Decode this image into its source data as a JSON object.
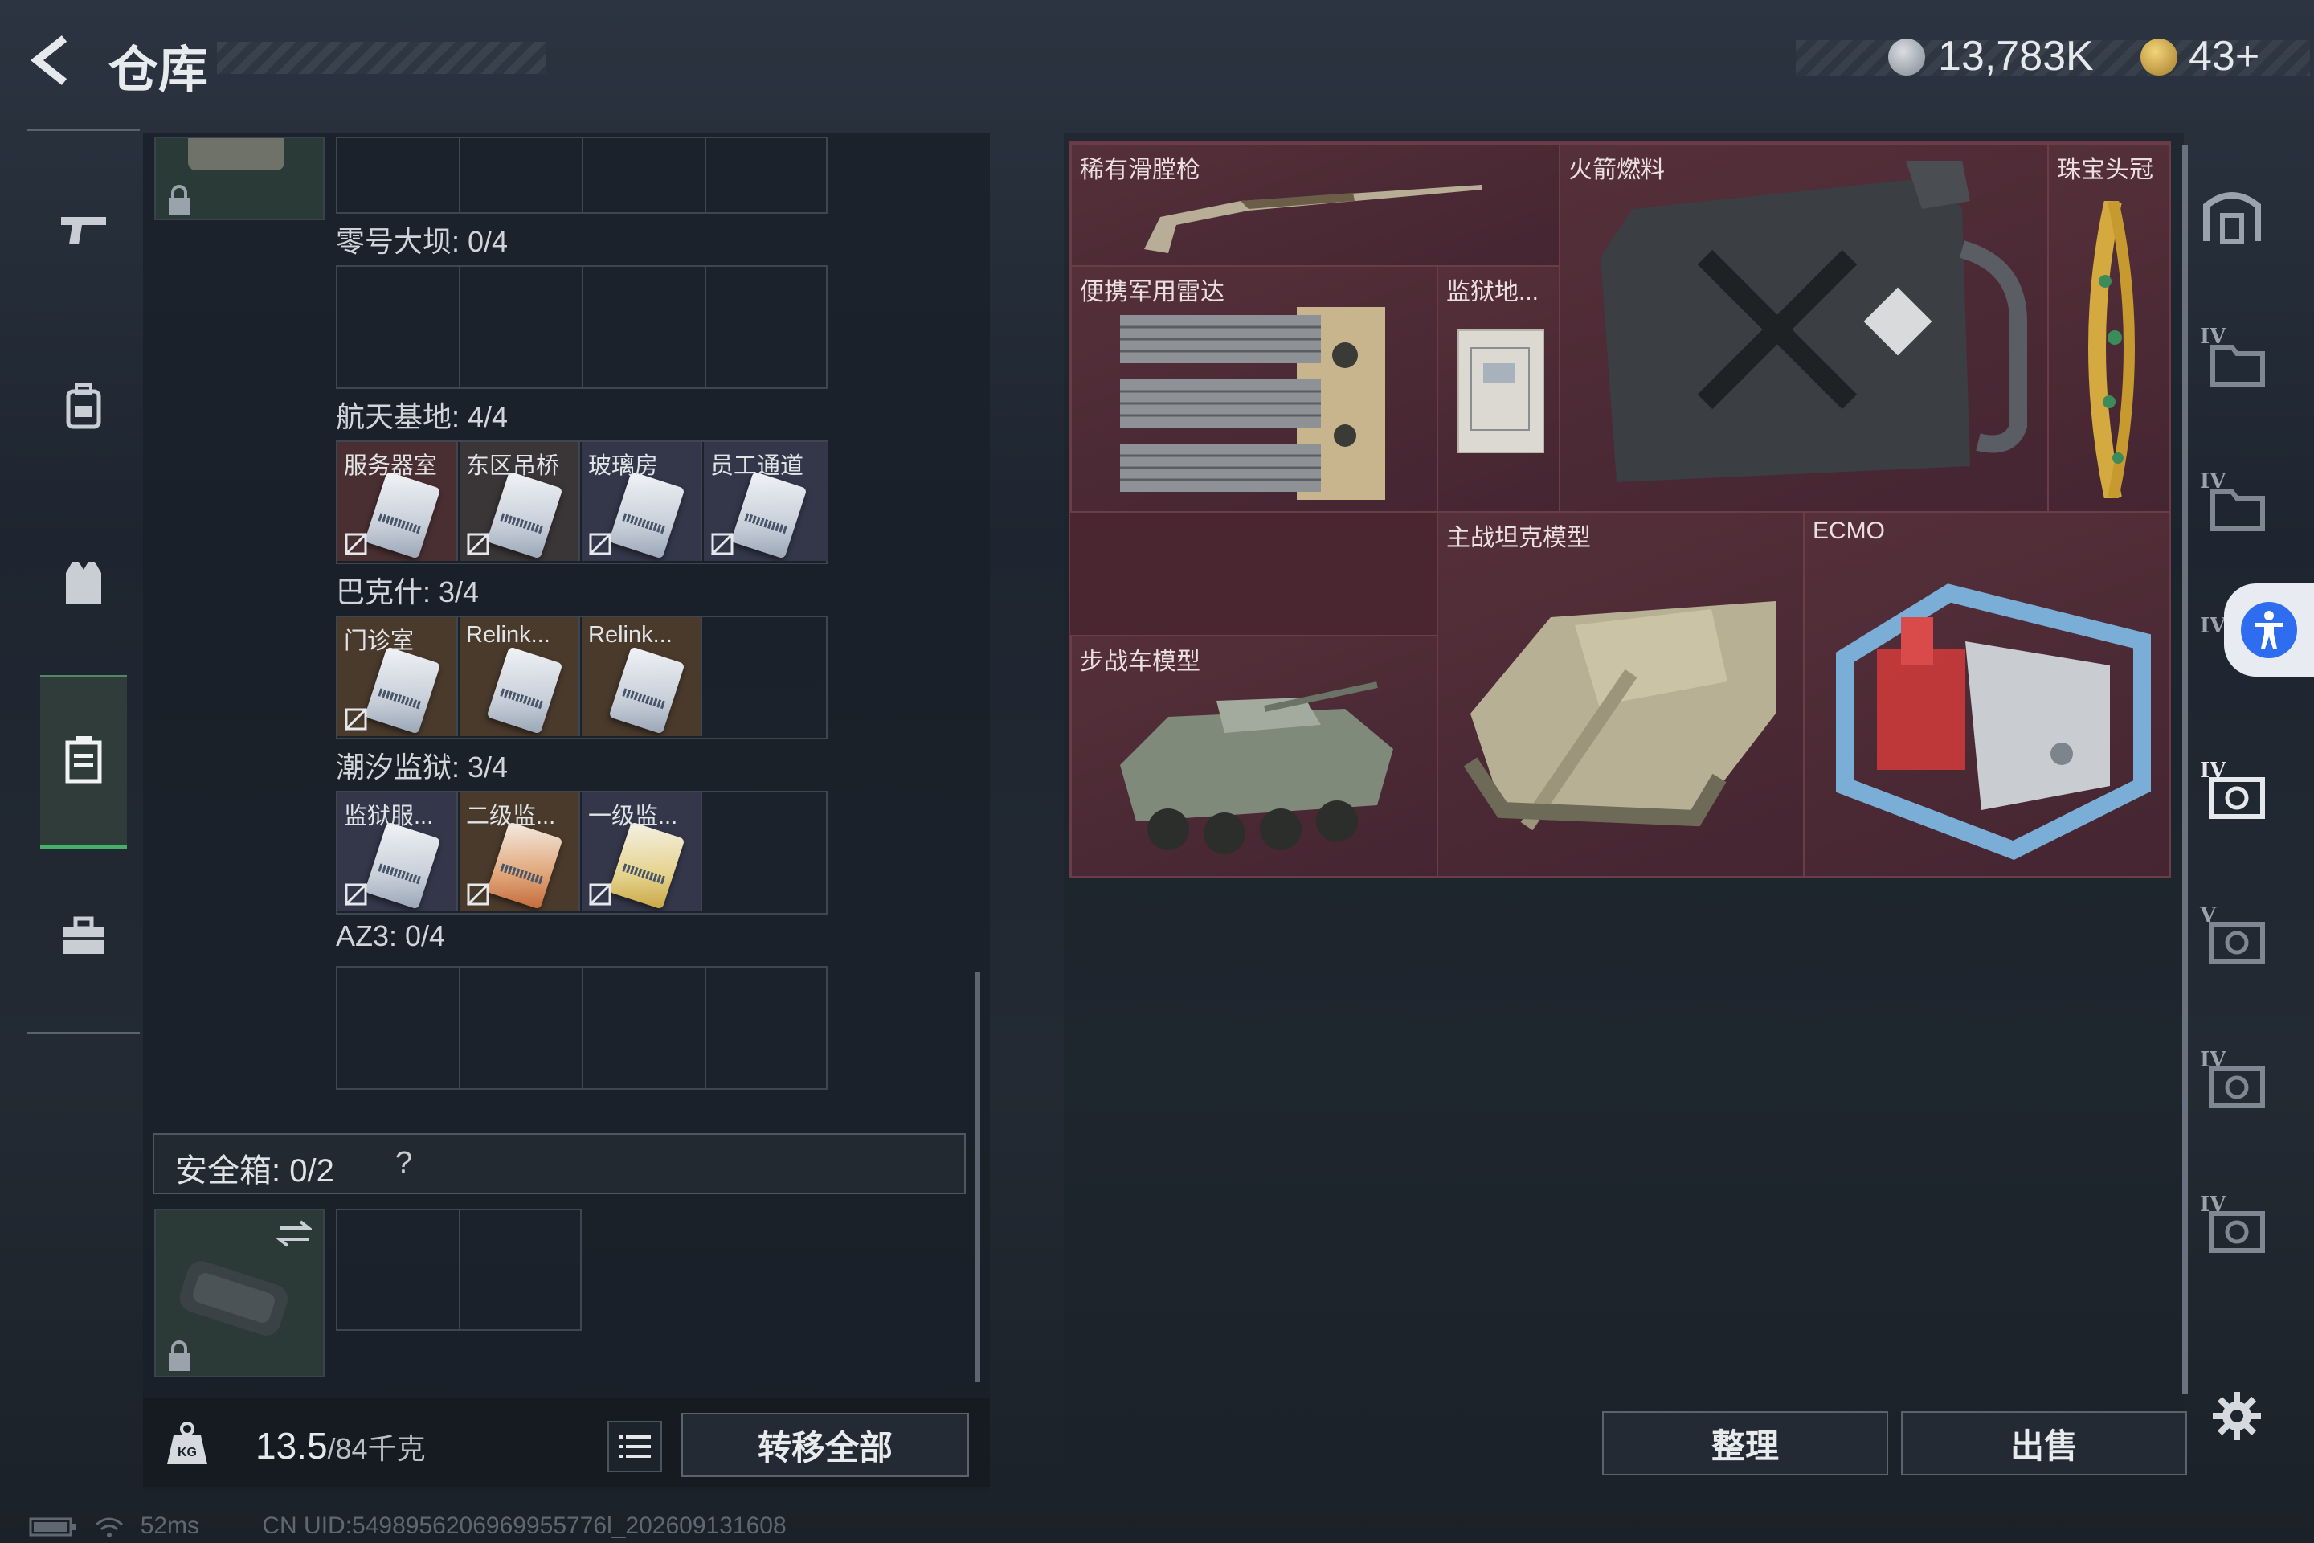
{
  "header": {
    "title": "仓库"
  },
  "currency": {
    "silver": "13,783K",
    "gold": "43+"
  },
  "left_nav": {
    "items": [
      "weapon-tab",
      "backpack-tab",
      "vest-tab",
      "keycard-case-tab",
      "toolbox-tab"
    ],
    "active": "keycard-case-tab"
  },
  "keycard_sections": [
    {
      "title": "零号大坝: 0/4",
      "cards": []
    },
    {
      "title": "航天基地: 4/4",
      "cards": [
        "服务器室",
        "东区吊桥",
        "玻璃房",
        "员工通道"
      ]
    },
    {
      "title": "巴克什: 3/4",
      "cards": [
        "门诊室",
        "Relink...",
        "Relink..."
      ]
    },
    {
      "title": "潮汐监狱: 3/4",
      "cards": [
        "监狱服...",
        "二级监...",
        "一级监..."
      ]
    },
    {
      "title": "AZ3: 0/4",
      "cards": []
    }
  ],
  "safe_box": {
    "label": "安全箱: 0/2",
    "help": "?"
  },
  "weight": {
    "current": "13.5",
    "max": "/84千克"
  },
  "buttons": {
    "transfer_all": "转移全部",
    "sort": "整理",
    "sell": "出售"
  },
  "items": [
    {
      "name": "稀有滑膛枪"
    },
    {
      "name": "火箭燃料"
    },
    {
      "name": "珠宝头冠"
    },
    {
      "name": "便携军用雷达"
    },
    {
      "name": "监狱地..."
    },
    {
      "name": "主战坦克模型"
    },
    {
      "name": "ECMO"
    },
    {
      "name": "步战车模型"
    }
  ],
  "right_tabs": {
    "tiers": [
      "IV",
      "IV",
      "IV",
      "IV",
      "V",
      "IV",
      "IV"
    ]
  },
  "status": {
    "ping": "52ms",
    "uid": "CN UID:5498956206969955776l_202609131608"
  },
  "colors": {
    "accent_green": "#45b06a",
    "item_bg": "#4a2630",
    "access_blue": "#2f6df0"
  }
}
